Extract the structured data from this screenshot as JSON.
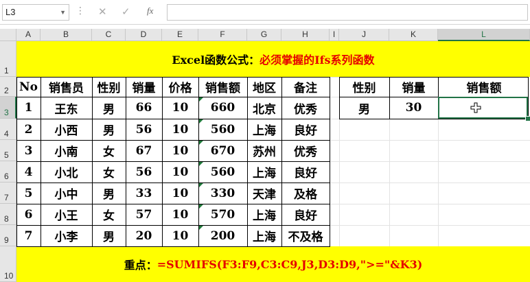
{
  "formula_bar": {
    "name_box": "L3",
    "formula": ""
  },
  "columns": [
    "A",
    "B",
    "C",
    "D",
    "E",
    "F",
    "G",
    "H",
    "I",
    "J",
    "K",
    "L"
  ],
  "rows": [
    "1",
    "2",
    "3",
    "4",
    "5",
    "6",
    "7",
    "8",
    "9",
    "10"
  ],
  "selected": {
    "column": "L",
    "row": "3"
  },
  "title": {
    "black": "Excel函数公式：",
    "red": "必须掌握的Ifs系列函数"
  },
  "table": {
    "headers": [
      "No",
      "销售员",
      "性别",
      "销量",
      "价格",
      "销售额",
      "地区",
      "备注"
    ],
    "rows": [
      [
        "1",
        "王东",
        "男",
        "66",
        "10",
        "660",
        "北京",
        "优秀"
      ],
      [
        "2",
        "小西",
        "男",
        "56",
        "10",
        "560",
        "上海",
        "良好"
      ],
      [
        "3",
        "小南",
        "女",
        "67",
        "10",
        "670",
        "苏州",
        "优秀"
      ],
      [
        "4",
        "小北",
        "女",
        "56",
        "10",
        "560",
        "上海",
        "良好"
      ],
      [
        "5",
        "小中",
        "男",
        "33",
        "10",
        "330",
        "天津",
        "及格"
      ],
      [
        "6",
        "小王",
        "女",
        "57",
        "10",
        "570",
        "上海",
        "良好"
      ],
      [
        "7",
        "小李",
        "男",
        "20",
        "10",
        "200",
        "上海",
        "不及格"
      ]
    ]
  },
  "criteria": {
    "headers": [
      "性别",
      "销量",
      "销售额"
    ],
    "values": [
      "男",
      "30",
      ""
    ]
  },
  "footer": {
    "label": "重点：",
    "formula": "=SUMIFS(F3:F9,C3:C9,J3,D3:D9,\">=\"&K3)"
  },
  "colors": {
    "banner": "#ffff00",
    "formula_red": "#e50000",
    "selection": "#217346"
  }
}
